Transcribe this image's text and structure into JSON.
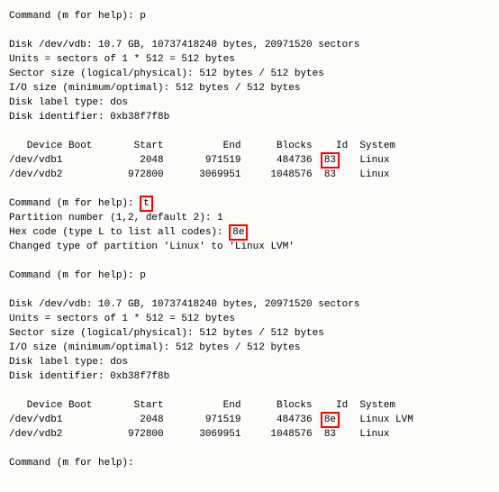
{
  "prompt": "Command (m for help): ",
  "cmd1": "p",
  "cmd2": "t",
  "cmd3": "p",
  "disk_info": {
    "line1": "Disk /dev/vdb: 10.7 GB, 10737418240 bytes, 20971520 sectors",
    "line2": "Units = sectors of 1 * 512 = 512 bytes",
    "line3": "Sector size (logical/physical): 512 bytes / 512 bytes",
    "line4": "I/O size (minimum/optimal): 512 bytes / 512 bytes",
    "line5": "Disk label type: dos",
    "line6": "Disk identifier: 0xb38f7f8b"
  },
  "part_header": {
    "device": "Device Boot",
    "start": "Start",
    "end": "End",
    "blocks": "Blocks",
    "id": "Id",
    "system": "System"
  },
  "parts_before": [
    {
      "device": "/dev/vdb1",
      "start": "2048",
      "end": "971519",
      "blocks": "484736",
      "id": "83",
      "system": "Linux",
      "hl": true
    },
    {
      "device": "/dev/vdb2",
      "start": "972800",
      "end": "3069951",
      "blocks": "1048576",
      "id": "83",
      "system": "Linux",
      "hl": false
    }
  ],
  "parts_after": [
    {
      "device": "/dev/vdb1",
      "start": "2048",
      "end": "971519",
      "blocks": "484736",
      "id": "8e",
      "system": "Linux LVM",
      "hl": true
    },
    {
      "device": "/dev/vdb2",
      "start": "972800",
      "end": "3069951",
      "blocks": "1048576",
      "id": "83",
      "system": "Linux",
      "hl": false
    }
  ],
  "t_step": {
    "partition_prompt": "Partition number (1,2, default 2): ",
    "partition_answer": "1",
    "hex_prompt": "Hex code (type L to list all codes): ",
    "hex_answer": "8e",
    "changed_line": "Changed type of partition 'Linux' to 'Linux LVM'"
  }
}
